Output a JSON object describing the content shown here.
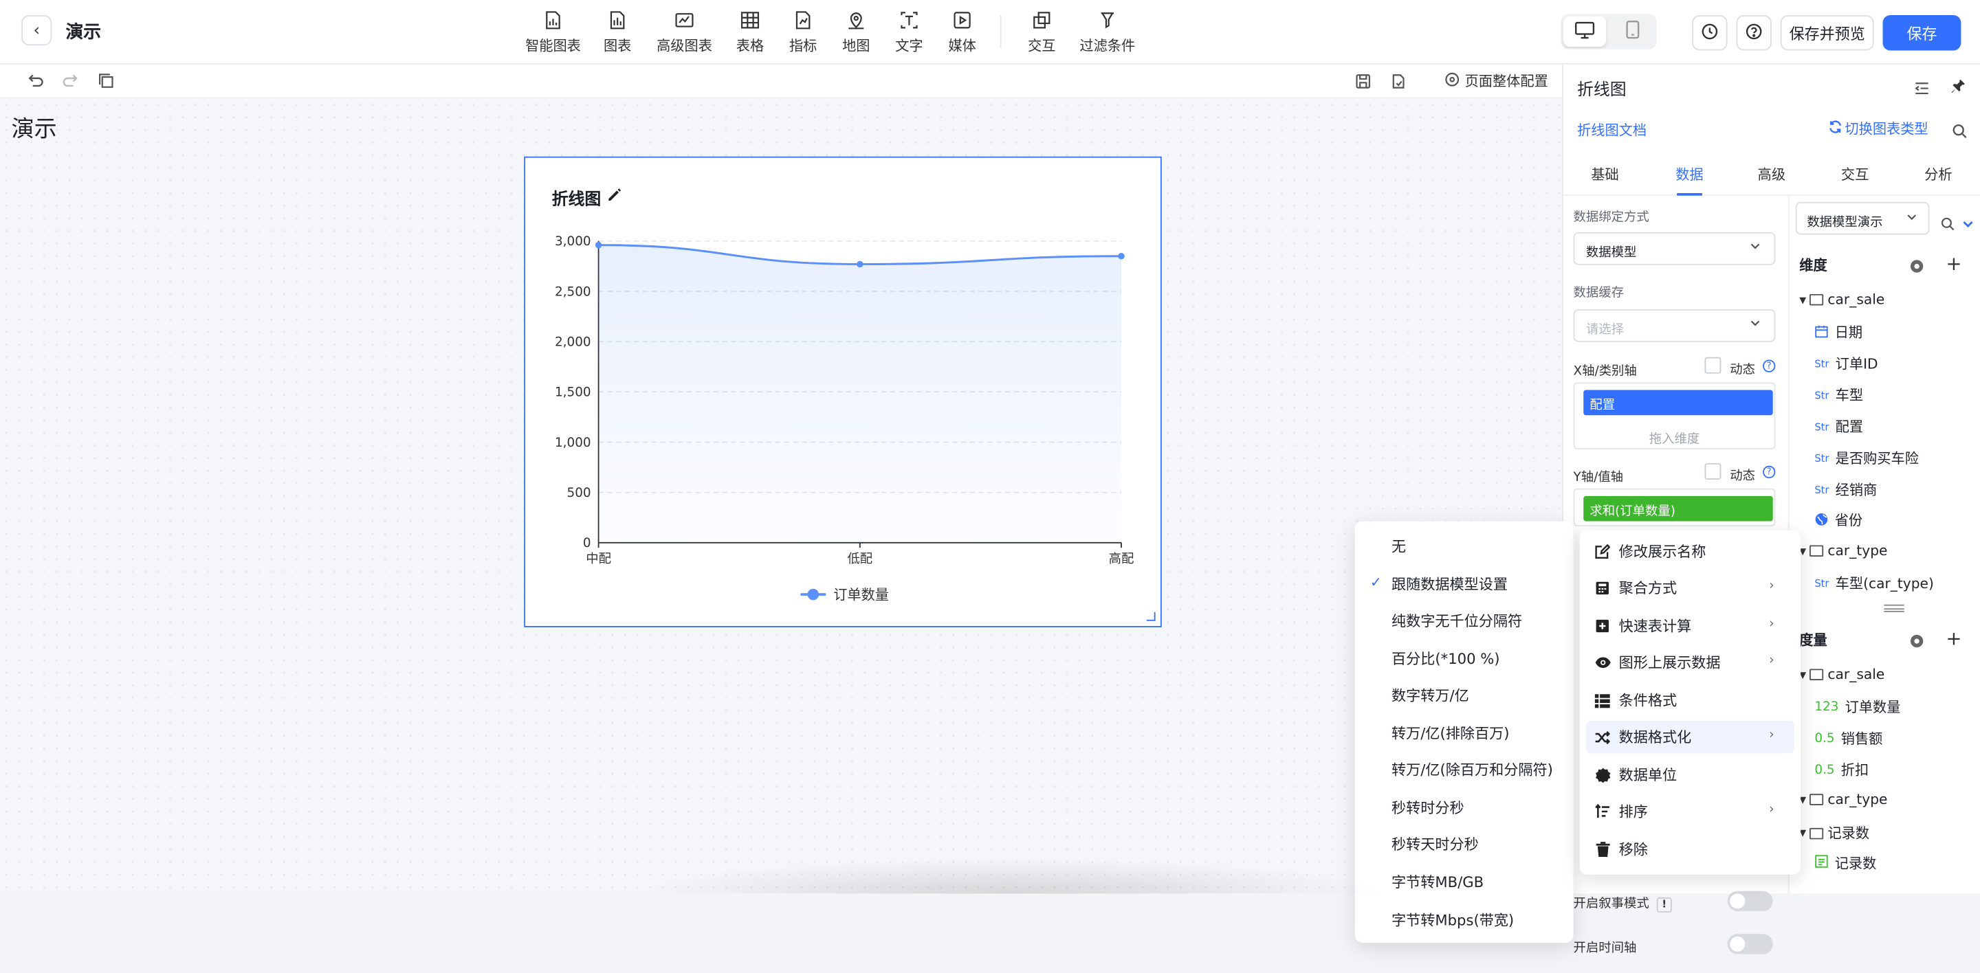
{
  "app": {
    "title": "演示"
  },
  "toolbar": {
    "items": [
      {
        "label": "智能图表",
        "icon": "smart-chart-icon"
      },
      {
        "label": "图表",
        "icon": "chart-icon"
      },
      {
        "label": "高级图表",
        "icon": "advanced-chart-icon"
      },
      {
        "label": "表格",
        "icon": "table-icon"
      },
      {
        "label": "指标",
        "icon": "metric-icon"
      },
      {
        "label": "地图",
        "icon": "map-icon"
      },
      {
        "label": "文字",
        "icon": "text-icon"
      },
      {
        "label": "媒体",
        "icon": "media-icon"
      },
      {
        "label": "交互",
        "icon": "interaction-icon"
      },
      {
        "label": "过滤条件",
        "icon": "filter-icon"
      }
    ],
    "save_preview_label": "保存并预览",
    "save_label": "保存"
  },
  "subbar": {
    "page_config_label": "页面整体配置"
  },
  "canvas": {
    "page_heading": "演示"
  },
  "chart_card": {
    "title": "折线图",
    "chart_data": {
      "type": "area",
      "title": "",
      "categories": [
        "中配",
        "低配",
        "高配"
      ],
      "series": [
        {
          "name": "订单数量",
          "values": [
            2960,
            2770,
            2850
          ]
        }
      ],
      "y_ticks": [
        "0",
        "500",
        "1,000",
        "1,500",
        "2,000",
        "2,500",
        "3,000"
      ],
      "ylim": [
        0,
        3000
      ],
      "grid": true,
      "legend": "bottom",
      "color": "#5b8ff9"
    }
  },
  "right_panel": {
    "title": "折线图",
    "doc_link": "折线图文档",
    "switch_type": "切换图表类型",
    "tabs": [
      "基础",
      "数据",
      "高级",
      "交互",
      "分析"
    ],
    "active_tab": "数据",
    "binding_label": "数据绑定方式",
    "binding_value": "数据模型",
    "cache_label": "数据缓存",
    "cache_placeholder": "请选择",
    "x_axis_label": "X轴/类别轴",
    "dynamic_label": "动态",
    "x_pill": "配置",
    "drop_dimension": "拖入维度",
    "y_axis_label": "Y轴/值轴",
    "y_pill": "求和(订单数量)",
    "story_mode_label": "开启叙事模式",
    "timeline_label": "开启时间轴",
    "model_select": "数据模型演示",
    "dimension_title": "维度",
    "dimension_tree": [
      {
        "kind": "folder",
        "label": "car_sale"
      },
      {
        "kind": "date",
        "label": "日期"
      },
      {
        "kind": "str",
        "label": "订单ID"
      },
      {
        "kind": "str",
        "label": "车型"
      },
      {
        "kind": "str",
        "label": "配置"
      },
      {
        "kind": "str",
        "label": "是否购买车险"
      },
      {
        "kind": "str",
        "label": "经销商"
      },
      {
        "kind": "geo",
        "label": "省份"
      },
      {
        "kind": "folder",
        "label": "car_type"
      },
      {
        "kind": "str",
        "label": "车型(car_type)"
      }
    ],
    "measure_title": "度量",
    "measure_tree": [
      {
        "kind": "folder",
        "label": "car_sale"
      },
      {
        "kind": "int",
        "label": "订单数量",
        "type_tag": "123"
      },
      {
        "kind": "float",
        "label": "销售额",
        "type_tag": "0.5"
      },
      {
        "kind": "float",
        "label": "折扣",
        "type_tag": "0.5"
      },
      {
        "kind": "folder",
        "label": "car_type"
      },
      {
        "kind": "folder",
        "label": "记录数"
      },
      {
        "kind": "count",
        "label": "记录数"
      }
    ],
    "str_tag": "Str"
  },
  "context_menu": {
    "items": [
      {
        "label": "修改展示名称",
        "icon": "edit-icon",
        "submenu": false
      },
      {
        "label": "聚合方式",
        "icon": "calculator-icon",
        "submenu": true
      },
      {
        "label": "快速表计算",
        "icon": "plus-square-icon",
        "submenu": true
      },
      {
        "label": "图形上展示数据",
        "icon": "eye-icon",
        "submenu": true
      },
      {
        "label": "条件格式",
        "icon": "list-icon",
        "submenu": false
      },
      {
        "label": "数据格式化",
        "icon": "shuffle-icon",
        "submenu": true,
        "highlighted": true
      },
      {
        "label": "数据单位",
        "icon": "badge-icon",
        "submenu": false
      },
      {
        "label": "排序",
        "icon": "sort-icon",
        "submenu": true
      },
      {
        "label": "移除",
        "icon": "trash-icon",
        "submenu": false
      }
    ]
  },
  "format_submenu": {
    "items": [
      "无",
      "跟随数据模型设置",
      "纯数字无千位分隔符",
      "百分比(*100 %)",
      "数字转万/亿",
      "转万/亿(排除百万)",
      "转万/亿(除百万和分隔符)",
      "秒转时分秒",
      "秒转天时分秒",
      "字节转MB/GB",
      "字节转Mbps(带宽)"
    ],
    "selected": "跟随数据模型设置"
  }
}
